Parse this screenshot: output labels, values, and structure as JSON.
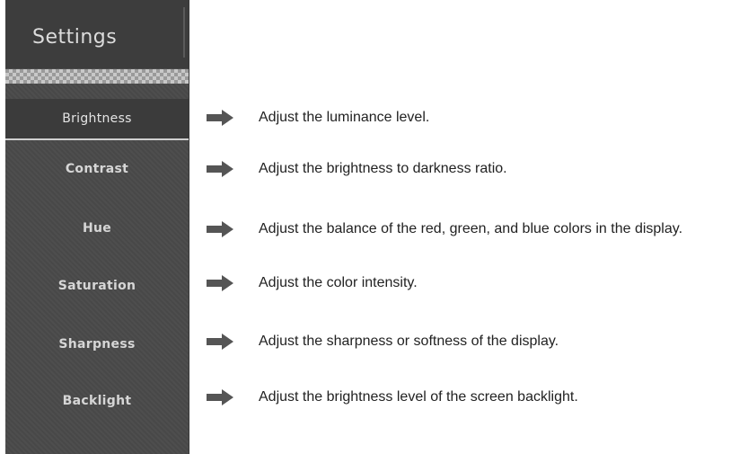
{
  "sidebar": {
    "title": "Settings",
    "items": [
      {
        "label": "Brightness",
        "selected": true
      },
      {
        "label": "Contrast",
        "selected": false
      },
      {
        "label": "Hue",
        "selected": false
      },
      {
        "label": "Saturation",
        "selected": false
      },
      {
        "label": "Sharpness",
        "selected": false
      },
      {
        "label": "Backlight",
        "selected": false
      }
    ]
  },
  "descriptions": [
    {
      "icon": "right-arrow-icon",
      "text": "Adjust the luminance level."
    },
    {
      "icon": "right-arrow-icon",
      "text": "Adjust the brightness to darkness ratio."
    },
    {
      "icon": "right-arrow-icon",
      "text": "Adjust the balance of the red, green, and blue colors in the display."
    },
    {
      "icon": "right-arrow-icon",
      "text": "Adjust the color intensity."
    },
    {
      "icon": "right-arrow-icon",
      "text": "Adjust the sharpness or softness of the display."
    },
    {
      "icon": "right-arrow-icon",
      "text": "Adjust the brightness level of the screen backlight."
    }
  ],
  "colors": {
    "sidebar_bg": "#4a4a4a",
    "arrow": "#555555",
    "text": "#222222"
  }
}
